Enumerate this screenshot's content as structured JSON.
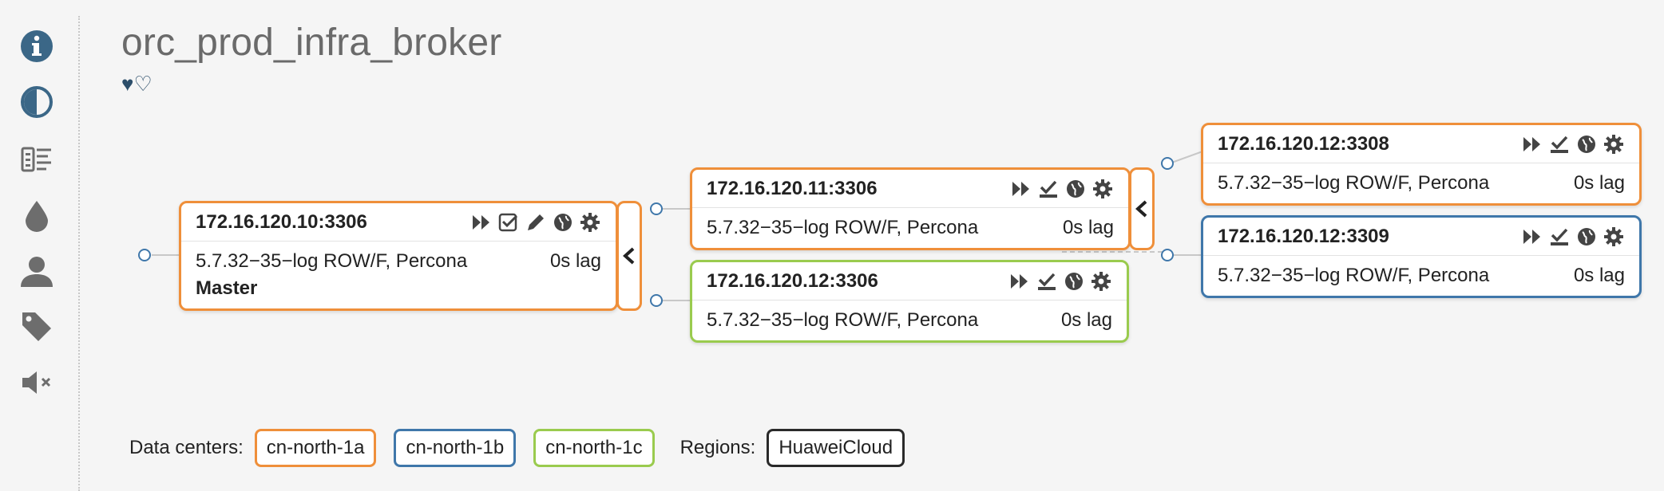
{
  "sidebar": {
    "icons": [
      "info-icon",
      "contrast-icon",
      "list-icon",
      "drop-icon",
      "user-icon",
      "tag-icon",
      "mute-icon"
    ]
  },
  "cluster": {
    "title": "orc_prod_infra_broker",
    "favorite_filled": "♥",
    "favorite_empty": "♡"
  },
  "instances": [
    {
      "address": "172.16.120.10:3306",
      "version": "5.7.32−35−log ROW/F, Percona",
      "lag": "0s lag",
      "role": "Master",
      "dc_color": "#ef8f3a"
    },
    {
      "address": "172.16.120.11:3306",
      "version": "5.7.32−35−log ROW/F, Percona",
      "lag": "0s lag",
      "dc_color": "#ef8f3a"
    },
    {
      "address": "172.16.120.12:3306",
      "version": "5.7.32−35−log ROW/F, Percona",
      "lag": "0s lag",
      "dc_color": "#9acb4e"
    },
    {
      "address": "172.16.120.12:3308",
      "version": "5.7.32−35−log ROW/F, Percona",
      "lag": "0s lag",
      "dc_color": "#ef8f3a"
    },
    {
      "address": "172.16.120.12:3309",
      "version": "5.7.32−35−log ROW/F, Percona",
      "lag": "0s lag",
      "dc_color": "#3f77aa"
    }
  ],
  "legend": {
    "data_centers_label": "Data centers:",
    "data_centers": [
      "cn-north-1a",
      "cn-north-1b",
      "cn-north-1c"
    ],
    "regions_label": "Regions:",
    "regions": [
      "HuaweiCloud"
    ]
  },
  "colors": {
    "accent": "#2c4e6a",
    "dc_a": "#ef8f3a",
    "dc_b": "#3f77aa",
    "dc_c": "#9acb4e"
  }
}
